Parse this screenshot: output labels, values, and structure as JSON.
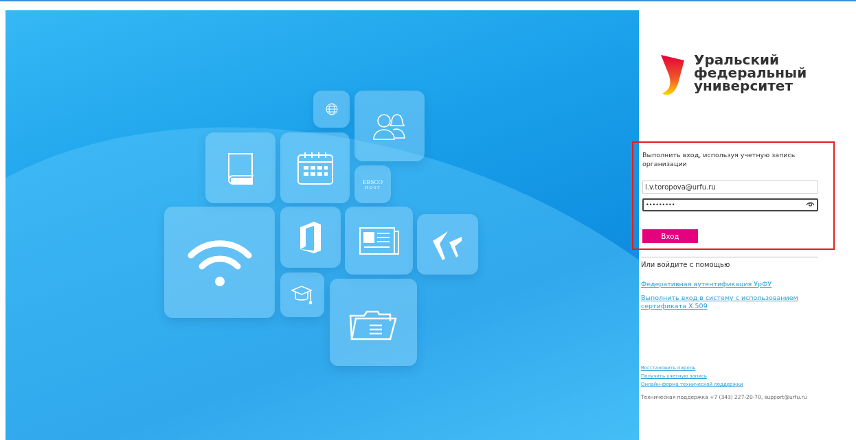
{
  "hero": {
    "ebsco_label": [
      "EBSCO",
      "HOST"
    ]
  },
  "logo": {
    "lines": [
      "Уральский",
      "федеральный",
      "университет"
    ]
  },
  "login": {
    "prompt": "Выполнить вход, используя учетную запись организации",
    "username": {
      "value": "l.v.toropova@urfu.ru",
      "focused": false
    },
    "password": {
      "value": "•••••••••",
      "focused": true
    },
    "submit": "Вход"
  },
  "alternative": {
    "heading": "Или войдите с помощью",
    "links": [
      "Федеративная аутентификация УрФУ",
      "Выполнить вход в систему с использованием сертификата X.509"
    ]
  },
  "footer": {
    "links": [
      "Восстановить пароль",
      "Получить учетную запись",
      "Онлайн-форма технической поддержки"
    ],
    "support": "Техническая поддержка +7 (343) 227-20-70, support@urfu.ru"
  }
}
